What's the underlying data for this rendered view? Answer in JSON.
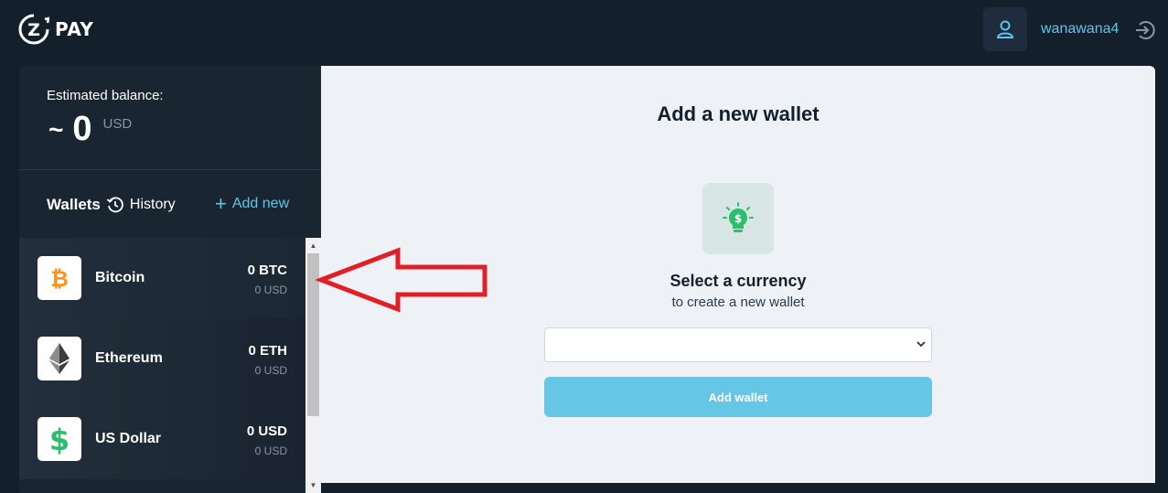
{
  "header": {
    "logo_letter": "Z",
    "logo_text": "PAY",
    "username": "wanawana4",
    "icons": [
      "user-icon",
      "logout-icon"
    ]
  },
  "sidebar": {
    "balance_label": "Estimated balance:",
    "balance_tilde": "~",
    "balance_amount": "0",
    "balance_unit": "USD",
    "tab_wallets": "Wallets",
    "tab_history": "History",
    "add_new": "Add new",
    "wallets": [
      {
        "name": "Bitcoin",
        "amount": "0 BTC",
        "usd": "0 USD",
        "icon": "bitcoin-icon",
        "color": "#f7931a"
      },
      {
        "name": "Ethereum",
        "amount": "0 ETH",
        "usd": "0 USD",
        "icon": "ethereum-icon",
        "color": "#3c3c3d"
      },
      {
        "name": "US Dollar",
        "amount": "0 USD",
        "usd": "0 USD",
        "icon": "dollar-icon",
        "color": "#2dbd6e"
      }
    ]
  },
  "main": {
    "title": "Add a new wallet",
    "select_title": "Select a currency",
    "select_subtitle": "to create a new wallet",
    "select_value": "",
    "add_button": "Add wallet"
  },
  "colors": {
    "background": "#141f2c",
    "accent": "#5ec6ea",
    "button": "#66c6e6",
    "annotation": "#e01f26"
  }
}
